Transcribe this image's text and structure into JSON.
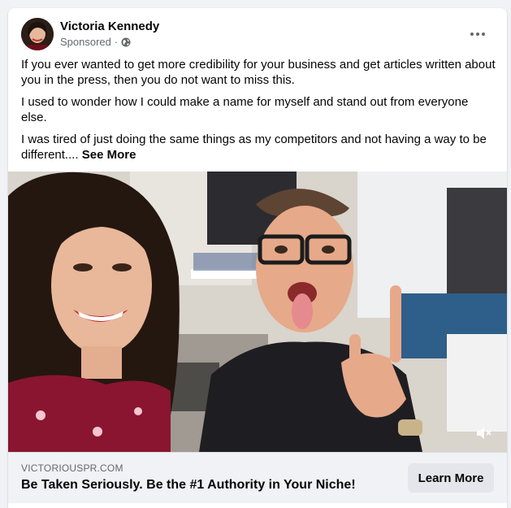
{
  "post": {
    "author": "Victoria Kennedy",
    "sponsored_label": "Sponsored",
    "separator": "·",
    "privacy_icon": "globe-icon",
    "more_icon": "more-options-icon",
    "paragraphs": [
      "If you ever wanted to get more credibility for your business and get articles written about you in the press, then you do not want to miss this.",
      "I used to wonder how I could make a name for myself and stand out from everyone else.",
      "I was tired of just doing the same things as my competitors and not having a way to be different...."
    ],
    "see_more": "See More"
  },
  "media": {
    "type": "video",
    "mute_icon": "muted-speaker-icon"
  },
  "ad_footer": {
    "domain": "VICTORIOUSPR.COM",
    "headline": "Be Taken Seriously. Be the #1 Authority in Your Niche!",
    "cta_label": "Learn More"
  },
  "colors": {
    "background": "#f0f2f5",
    "card": "#ffffff",
    "secondary_text": "#65676b",
    "button_bg": "#e4e6eb"
  }
}
